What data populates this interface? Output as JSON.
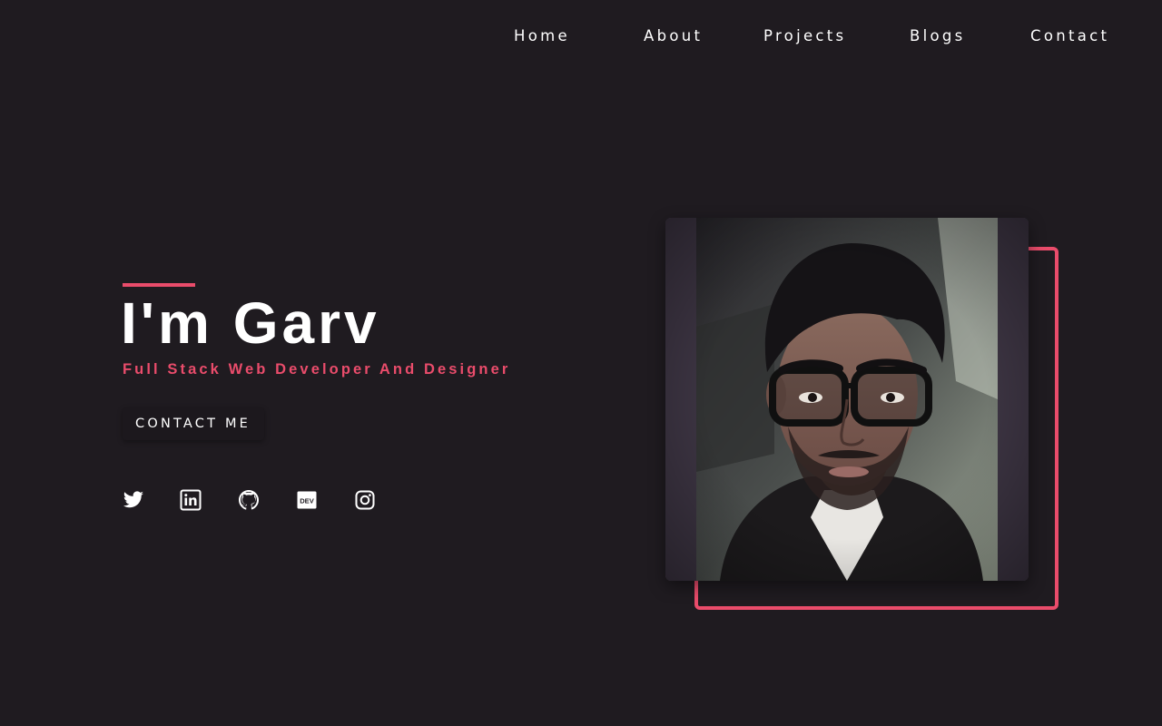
{
  "nav": {
    "items": [
      {
        "label": "Home"
      },
      {
        "label": "About"
      },
      {
        "label": "Projects"
      },
      {
        "label": "Blogs"
      },
      {
        "label": "Contact"
      }
    ]
  },
  "hero": {
    "title": "I'm Garv",
    "subtitle": "Full Stack Web Developer And Designer",
    "cta_label": "CONTACT ME"
  },
  "social": [
    {
      "icon": "twitter-icon"
    },
    {
      "icon": "linkedin-icon"
    },
    {
      "icon": "github-icon"
    },
    {
      "icon": "dev-icon",
      "text": "DEV"
    },
    {
      "icon": "instagram-icon"
    }
  ],
  "colors": {
    "background": "#1f1b20",
    "accent": "#ea4c6b",
    "text": "#ffffff"
  }
}
